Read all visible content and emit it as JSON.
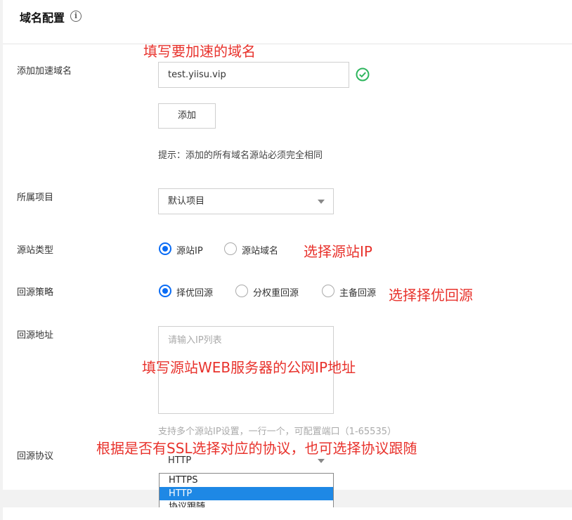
{
  "header": {
    "title": "域名配置",
    "info_icon": "info-icon"
  },
  "domain": {
    "label": "添加加速域名",
    "value": "test.yiisu.vip",
    "status_icon": "check-circle-icon",
    "add_button": "添加",
    "hint": "提示：添加的所有域名源站必须完全相同"
  },
  "project": {
    "label": "所属项目",
    "selected": "默认项目"
  },
  "origin_type": {
    "label": "源站类型",
    "options": [
      "源站IP",
      "源站域名"
    ],
    "selected_index": 0
  },
  "origin_policy": {
    "label": "回源策略",
    "options": [
      "择优回源",
      "分权重回源",
      "主备回源"
    ],
    "selected_index": 0
  },
  "origin_address": {
    "label": "回源地址",
    "placeholder": "请输入IP列表",
    "hint": "支持多个源站IP设置，一行一个，可配置端口（1-65535）"
  },
  "protocol": {
    "label": "回源协议",
    "selected": "HTTP",
    "options": [
      "HTTPS",
      "HTTP",
      "协议跟随"
    ],
    "highlighted_index": 1
  },
  "annotations": {
    "domain": "填写要加速的域名",
    "origin_type": "选择源站IP",
    "origin_policy": "选择择优回源",
    "origin_address": "填写源站WEB服务器的公网IP地址",
    "protocol": "根据是否有SSL选择对应的协议，也可选择协议跟随"
  },
  "colors": {
    "accent": "#0a6cf5",
    "annotation": "#e8322c",
    "success": "#2db55d",
    "selected_option": "#1e88e5"
  }
}
